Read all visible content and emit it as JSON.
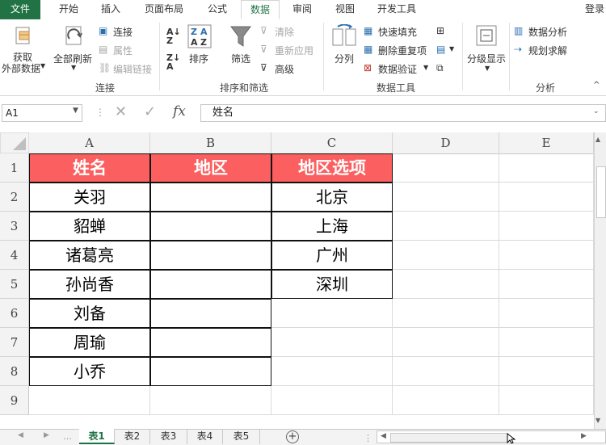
{
  "ribbon_tabs": [
    "文件",
    "开始",
    "插入",
    "页面布局",
    "公式",
    "数据",
    "审阅",
    "视图",
    "开发工具"
  ],
  "active_tab": "数据",
  "user_label": "登录",
  "groups": {
    "connections": {
      "label": "连接",
      "get_external_line1": "获取",
      "get_external_line2": "外部数据",
      "refresh_all": "全部刷新",
      "connections": "连接",
      "properties": "属性",
      "edit_links": "编辑链接"
    },
    "sort_filter": {
      "label": "排序和筛选",
      "sort": "排序",
      "filter": "筛选",
      "clear": "清除",
      "reapply": "重新应用",
      "advanced": "高级"
    },
    "data_tools": {
      "label": "数据工具",
      "text_to_columns": "分列",
      "flash_fill": "快速填充",
      "remove_duplicates": "删除重复项",
      "data_validation": "数据验证"
    },
    "outline": {
      "outline_show": "分级显示"
    },
    "analysis": {
      "label": "分析",
      "data_analysis": "数据分析",
      "solver": "规划求解"
    }
  },
  "formula_bar": {
    "name_box": "A1",
    "fx": "fx",
    "value": "姓名"
  },
  "columns": [
    "A",
    "B",
    "C",
    "D",
    "E"
  ],
  "rows": [
    "1",
    "2",
    "3",
    "4",
    "5",
    "6",
    "7",
    "8",
    "9"
  ],
  "cells": {
    "A1": "姓名",
    "B1": "地区",
    "C1": "地区选项",
    "A2": "关羽",
    "A3": "貂蝉",
    "A4": "诸葛亮",
    "A5": "孙尚香",
    "A6": "刘备",
    "A7": "周瑜",
    "A8": "小乔",
    "C2": "北京",
    "C3": "上海",
    "C4": "广州",
    "C5": "深圳"
  },
  "sheets": [
    "表1",
    "表2",
    "表3",
    "表4",
    "表5"
  ],
  "active_sheet": "表1",
  "colors": {
    "header_fill": "#fb5f5f",
    "accent": "#217346"
  }
}
